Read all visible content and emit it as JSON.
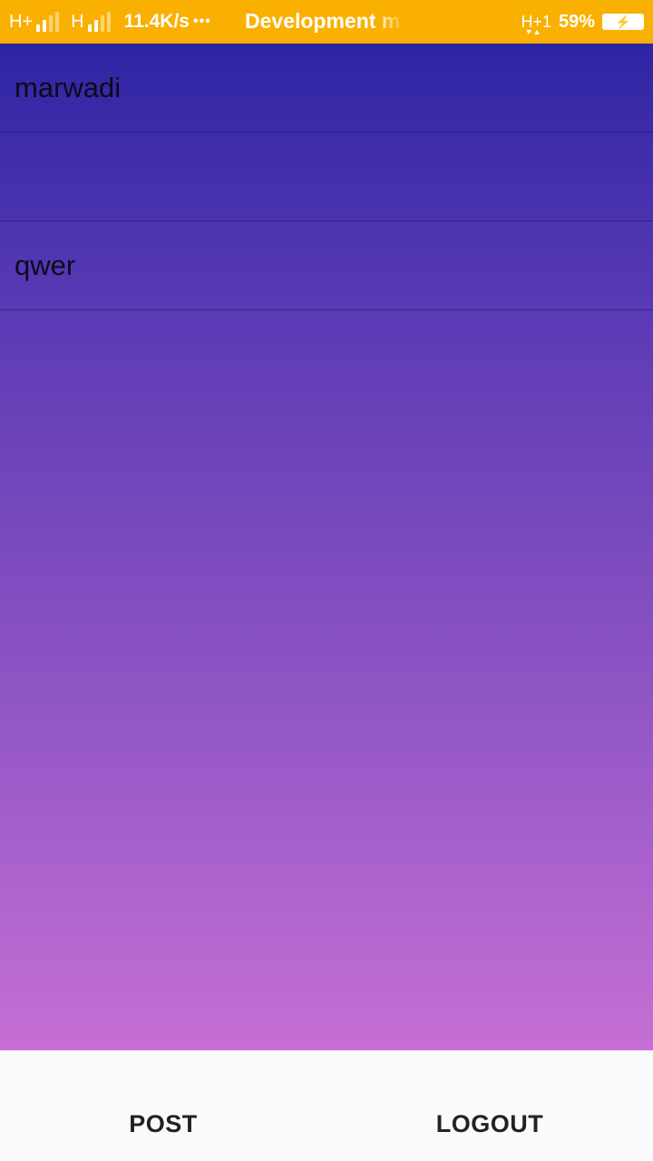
{
  "status_bar": {
    "network_1": "H+",
    "network_2": "H",
    "speed": "11.4K/s",
    "overflow_dots": "•••",
    "notification_title": "Development m",
    "network_3": "H+1",
    "battery_percent": "59%",
    "accent_color": "#F9B000",
    "icons": [
      "signal-icon",
      "signal-icon",
      "data-arrows-icon",
      "battery-charging-icon"
    ]
  },
  "list": {
    "items": [
      {
        "label": "marwadi"
      },
      {
        "label": ""
      },
      {
        "label": "qwer"
      }
    ]
  },
  "bottom_bar": {
    "post_label": "POST",
    "logout_label": "LOGOUT"
  },
  "colors": {
    "gradient_top": "#2E25A3",
    "gradient_bottom": "#C66FD5",
    "bottom_bar_bg": "#FAFAFA"
  }
}
